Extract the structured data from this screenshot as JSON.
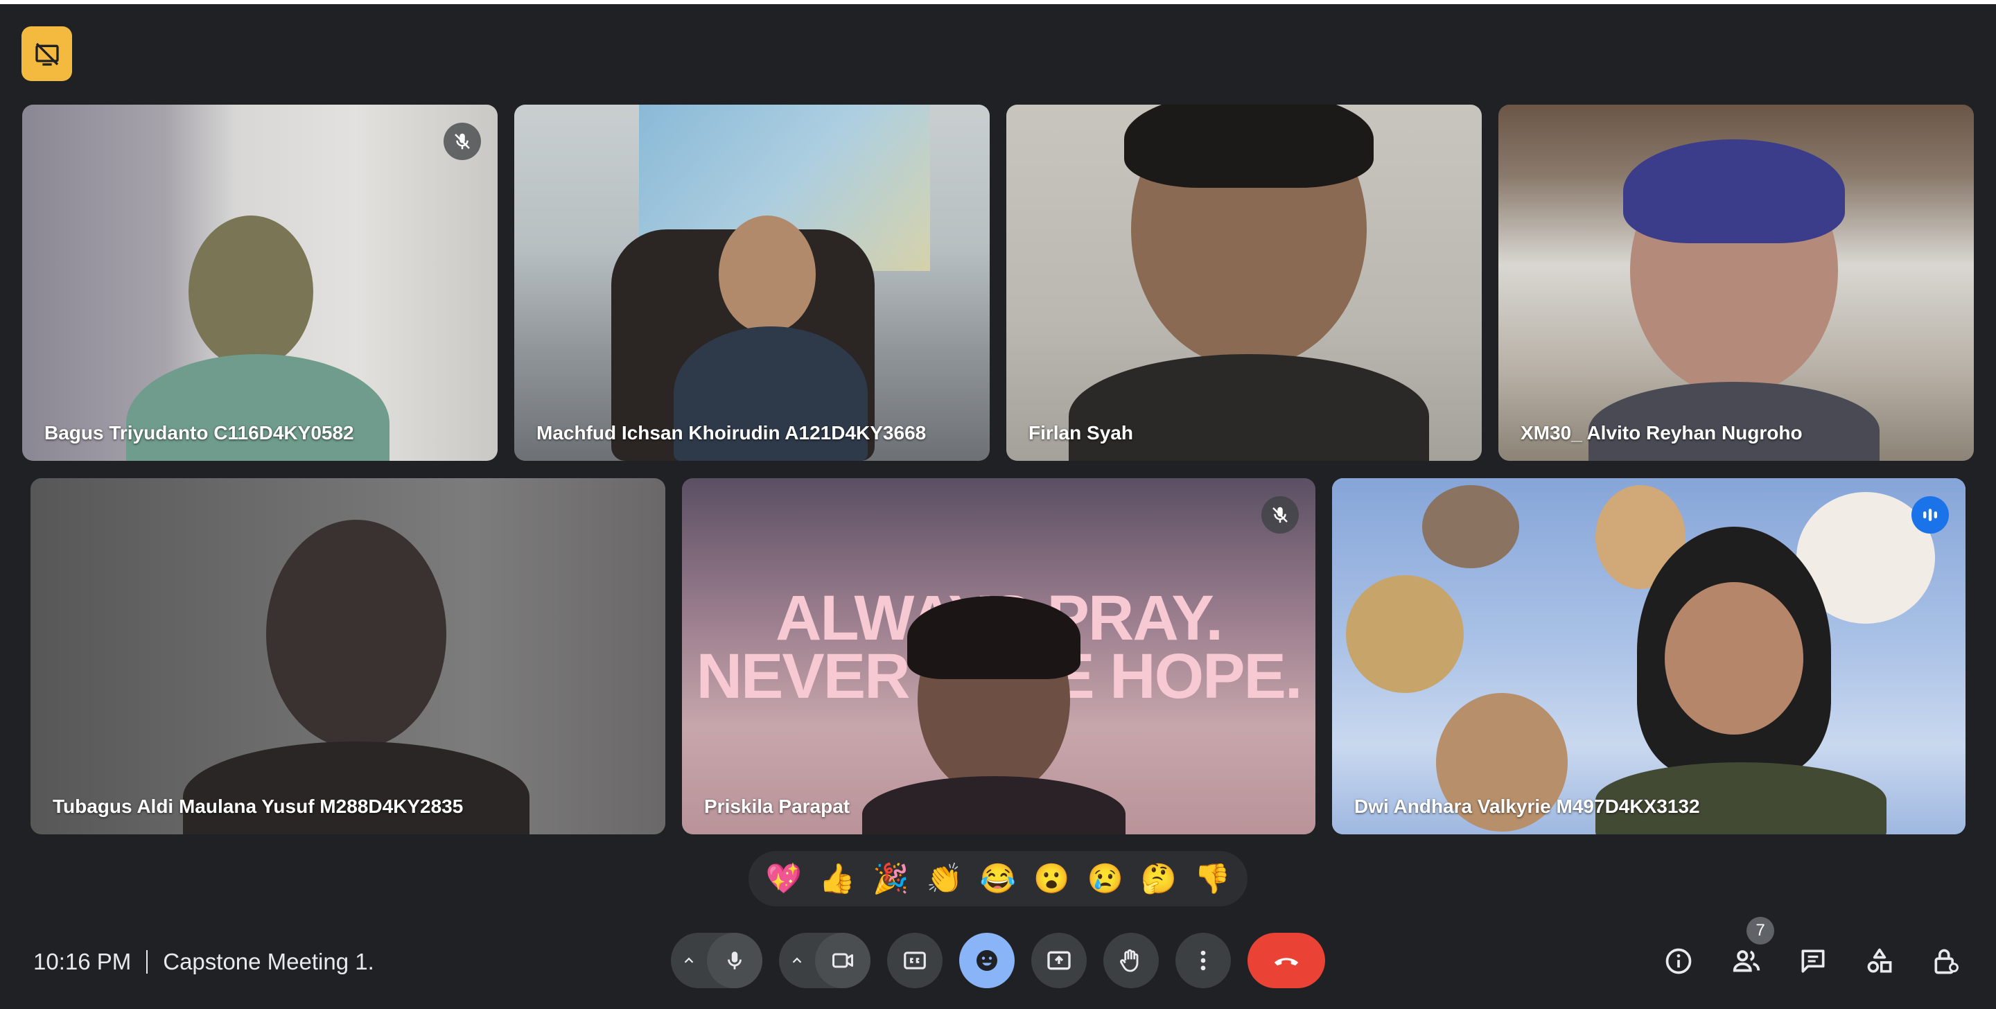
{
  "meeting": {
    "time": "10:16 PM",
    "title": "Capstone Meeting 1."
  },
  "participants": [
    {
      "name": "Bagus Triyudanto C116D4KY0582",
      "muted": true,
      "speaking": false
    },
    {
      "name": "Machfud Ichsan Khoirudin A121D4KY3668",
      "muted": false,
      "speaking": false
    },
    {
      "name": "Firlan Syah",
      "muted": false,
      "speaking": false
    },
    {
      "name": "XM30_ Alvito Reyhan Nugroho",
      "muted": false,
      "speaking": false
    },
    {
      "name": "Tubagus Aldi Maulana Yusuf M288D4KY2835",
      "muted": false,
      "speaking": false
    },
    {
      "name": "Priskila Parapat",
      "muted": true,
      "speaking": false
    },
    {
      "name": "Dwi Andhara Valkyrie M497D4KX3132",
      "muted": false,
      "speaking": true
    }
  ],
  "background_text": {
    "line1": "ALWAYS PRAY.",
    "line2": "NEVER LOSE HOPE."
  },
  "reactions": [
    "💖",
    "👍",
    "🎉",
    "👏",
    "😂",
    "😮",
    "😢",
    "🤔",
    "👎"
  ],
  "controls": {
    "people_count": "7"
  },
  "icons": {
    "present": "present-stop-icon",
    "mic": "mic-icon",
    "camera": "camera-icon",
    "captions": "captions-icon",
    "emoji": "emoji-icon",
    "share": "present-screen-icon",
    "hand": "raise-hand-icon",
    "more": "more-vert-icon",
    "end": "end-call-icon",
    "info": "info-icon",
    "people": "people-icon",
    "chat": "chat-icon",
    "activities": "activities-icon",
    "host": "host-controls-icon"
  },
  "colors": {
    "background": "#202124",
    "accent_yellow": "#f4b93f",
    "end_call": "#ea4335",
    "active_speaker": "#8ab4f8",
    "emoji_active": "#8ab4f8"
  }
}
